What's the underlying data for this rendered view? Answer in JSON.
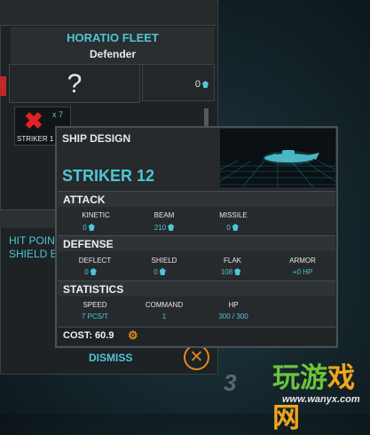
{
  "fleet": {
    "name": "HORATIO FLEET",
    "role": "Defender",
    "unknown_slot": "?",
    "credits": "0",
    "ship_card": {
      "quantity": "x 7",
      "name": "STRIKER 1"
    },
    "hit_points_label": "HIT POIN",
    "shield_label": "SHIELD E",
    "dismiss_label": "DISMISS"
  },
  "tooltip": {
    "title": "SHIP DESIGN",
    "design_name": "STRIKER 12",
    "attack": {
      "heading": "ATTACK",
      "stats": [
        {
          "label": "KINETIC",
          "value": "0"
        },
        {
          "label": "BEAM",
          "value": "210"
        },
        {
          "label": "MISSILE",
          "value": "0"
        }
      ]
    },
    "defense": {
      "heading": "DEFENSE",
      "stats": [
        {
          "label": "DEFLECT",
          "value": "0"
        },
        {
          "label": "SHIELD",
          "value": "0"
        },
        {
          "label": "FLAK",
          "value": "108"
        },
        {
          "label": "ARMOR",
          "value": "+0 HP"
        }
      ]
    },
    "statistics": {
      "heading": "STATISTICS",
      "stats": [
        {
          "label": "SPEED",
          "value": "7 PCS/T"
        },
        {
          "label": "COMMAND",
          "value": "1"
        },
        {
          "label": "HP",
          "value": "300 / 300"
        }
      ]
    },
    "cost": "COST: 60.9"
  },
  "watermark": {
    "number": "3",
    "logo_part1": "玩游",
    "logo_part2": "戏网",
    "url": "www.wanyx.com"
  },
  "colors": {
    "accent": "#4fc5d5",
    "panel": "#262a2c",
    "cost_icon": "#e08a1c",
    "destroyed": "#e02424"
  },
  "icons": [
    "question-icon",
    "credit-gem-icon",
    "destroyed-x-icon",
    "dust-gem-icon",
    "gear-icon",
    "close-icon"
  ]
}
